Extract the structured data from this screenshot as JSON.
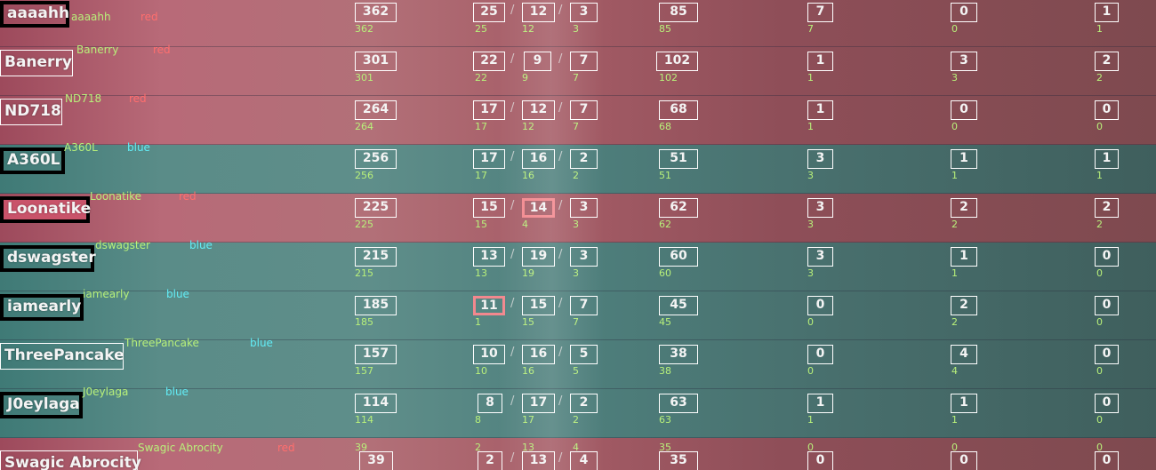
{
  "rows": [
    {
      "name": "aaaahh",
      "tag": "aaaahh",
      "team": "red",
      "score": "362",
      "kills": "25",
      "deaths": "12",
      "assists": "3",
      "col5": "85",
      "col6": "7",
      "col7": "0",
      "col8": "1",
      "sub": {
        "score": "362",
        "kills": "25",
        "deaths": "12",
        "assists": "3",
        "col5": "85",
        "col6": "7",
        "col7": "0",
        "col8": "1"
      }
    },
    {
      "name": "Banerry",
      "tag": "Banerry",
      "team": "red",
      "score": "301",
      "kills": "22",
      "deaths": "9",
      "assists": "7",
      "col5": "102",
      "col6": "1",
      "col7": "3",
      "col8": "2",
      "sub": {
        "score": "301",
        "kills": "22",
        "deaths": "9",
        "assists": "7",
        "col5": "102",
        "col6": "1",
        "col7": "3",
        "col8": "2"
      }
    },
    {
      "name": "ND718",
      "tag": "ND718",
      "team": "red",
      "score": "264",
      "kills": "17",
      "deaths": "12",
      "assists": "7",
      "col5": "68",
      "col6": "1",
      "col7": "0",
      "col8": "0",
      "sub": {
        "score": "264",
        "kills": "17",
        "deaths": "12",
        "assists": "7",
        "col5": "68",
        "col6": "1",
        "col7": "0",
        "col8": "0"
      }
    },
    {
      "name": "A360L",
      "tag": "A360L",
      "team": "blue",
      "score": "256",
      "kills": "17",
      "deaths": "16",
      "assists": "2",
      "col5": "51",
      "col6": "3",
      "col7": "1",
      "col8": "1",
      "sub": {
        "score": "256",
        "kills": "17",
        "deaths": "16",
        "assists": "2",
        "col5": "51",
        "col6": "3",
        "col7": "1",
        "col8": "1"
      }
    },
    {
      "name": "Loonatike",
      "tag": "Loonatike",
      "team": "red",
      "score": "225",
      "kills": "15",
      "deaths": "14",
      "assists": "3",
      "col5": "62",
      "col6": "3",
      "col7": "2",
      "col8": "2",
      "sub": {
        "score": "225",
        "kills": "15",
        "deaths": "4",
        "assists": "3",
        "col5": "62",
        "col6": "3",
        "col7": "2",
        "col8": "2"
      }
    },
    {
      "name": "dswagster",
      "tag": "dswagster",
      "team": "blue",
      "score": "215",
      "kills": "13",
      "deaths": "19",
      "assists": "3",
      "col5": "60",
      "col6": "3",
      "col7": "1",
      "col8": "0",
      "sub": {
        "score": "215",
        "kills": "13",
        "deaths": "19",
        "assists": "3",
        "col5": "60",
        "col6": "3",
        "col7": "1",
        "col8": "0"
      }
    },
    {
      "name": "iamearly",
      "tag": "iamearly",
      "team": "blue",
      "score": "185",
      "kills": "11",
      "deaths": "15",
      "assists": "7",
      "col5": "45",
      "col6": "0",
      "col7": "2",
      "col8": "0",
      "sub": {
        "score": "185",
        "kills": "1",
        "deaths": "15",
        "assists": "7",
        "col5": "45",
        "col6": "0",
        "col7": "2",
        "col8": "0"
      }
    },
    {
      "name": "ThreePancake",
      "tag": "ThreePancake",
      "team": "blue",
      "score": "157",
      "kills": "10",
      "deaths": "16",
      "assists": "5",
      "col5": "38",
      "col6": "0",
      "col7": "4",
      "col8": "0",
      "sub": {
        "score": "157",
        "kills": "10",
        "deaths": "16",
        "assists": "5",
        "col5": "38",
        "col6": "0",
        "col7": "4",
        "col8": "0"
      }
    },
    {
      "name": "J0eylaga",
      "tag": "J0eylaga",
      "team": "blue",
      "score": "114",
      "kills": "8",
      "deaths": "17",
      "assists": "2",
      "col5": "63",
      "col6": "1",
      "col7": "1",
      "col8": "0",
      "sub": {
        "score": "114",
        "kills": "8",
        "deaths": "17",
        "assists": "2",
        "col5": "63",
        "col6": "1",
        "col7": "1",
        "col8": "0"
      }
    },
    {
      "name": "Swagic Abrocity",
      "tag": "Swagic Abrocity",
      "team": "red",
      "score": "39",
      "kills": "2",
      "deaths": "13",
      "assists": "4",
      "col5": "35",
      "col6": "0",
      "col7": "0",
      "col8": "0",
      "sub": {
        "score": "39",
        "kills": "2",
        "deaths": "13",
        "assists": "4",
        "col5": "35",
        "col6": "0",
        "col7": "0",
        "col8": "0"
      }
    }
  ],
  "colors": {
    "red_team": "#ff6e6e",
    "blue_team": "#62ecf5",
    "label_green": "#b8f07a",
    "highlight": "#f2888e"
  }
}
